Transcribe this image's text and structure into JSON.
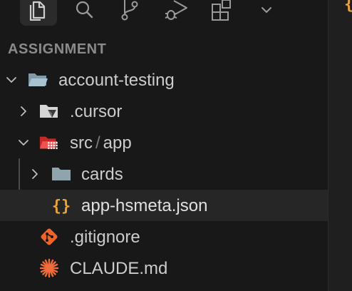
{
  "activity_bar": {
    "items": [
      {
        "id": "explorer",
        "icon": "files-icon",
        "active": true
      },
      {
        "id": "search",
        "icon": "search-icon",
        "active": false
      },
      {
        "id": "scm",
        "icon": "source-control-icon",
        "active": false
      },
      {
        "id": "debug",
        "icon": "run-debug-icon",
        "active": false
      },
      {
        "id": "extensions",
        "icon": "extensions-icon",
        "active": false
      },
      {
        "id": "more",
        "icon": "chevron-down-icon",
        "active": false
      }
    ]
  },
  "explorer": {
    "section_title": "ASSIGNMENT",
    "tree": [
      {
        "label": "account-testing",
        "type": "folder-open",
        "expanded": true
      },
      {
        "label": ".cursor",
        "type": "folder",
        "expanded": false
      },
      {
        "label_part1": "src",
        "label_sep": "/",
        "label_part2": "app",
        "type": "folder-open",
        "expanded": true
      },
      {
        "label": "cards",
        "type": "folder",
        "expanded": false
      },
      {
        "label": "app-hsmeta.json",
        "type": "json-file",
        "selected": true
      },
      {
        "label": ".gitignore",
        "type": "git-file"
      },
      {
        "label": "CLAUDE.md",
        "type": "claude-file"
      }
    ]
  },
  "editor": {
    "partial_glyph": "{"
  },
  "colors": {
    "background": "#181818",
    "selected_row": "#262626",
    "json_icon": "#e8a33c",
    "git_icon": "#f0642b",
    "claude_icon": "#f26b3a",
    "folder_icon": "#90a4ae",
    "src_folder_icon": "#ef5350"
  }
}
